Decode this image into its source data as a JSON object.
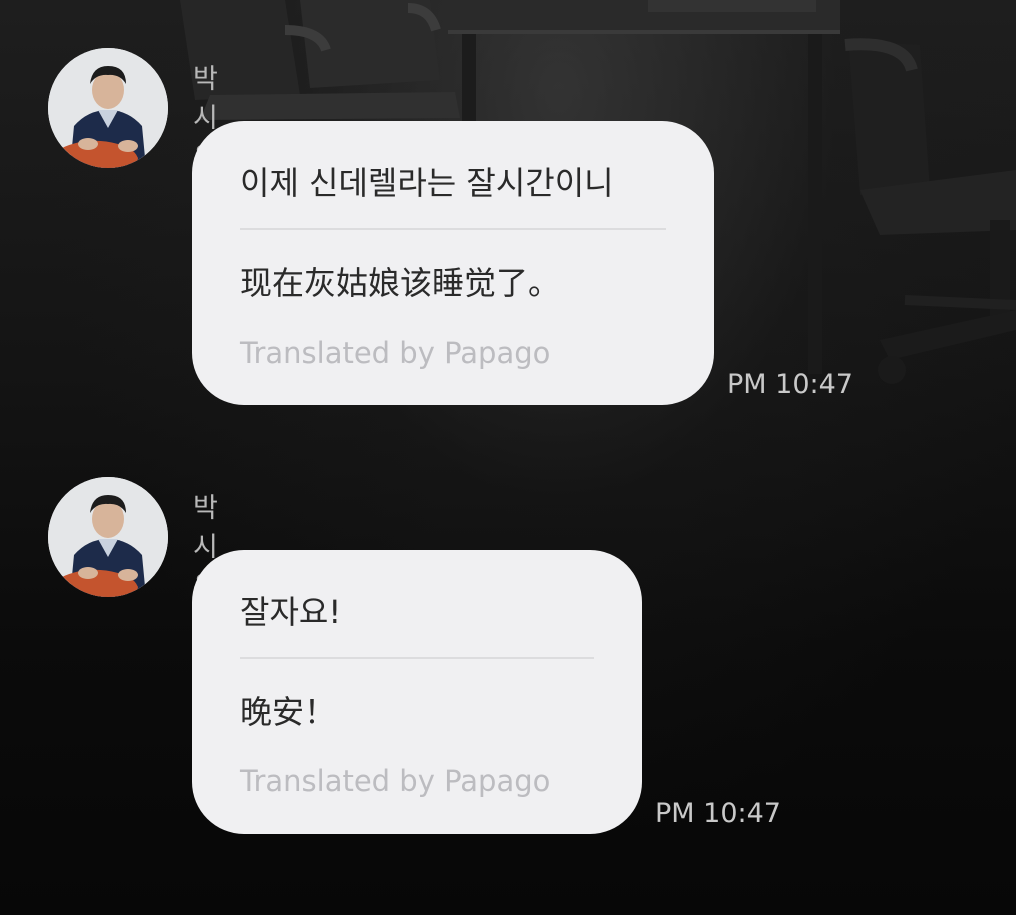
{
  "messages": [
    {
      "sender": "박시우",
      "original": "이제 신데렐라는 잘시간이니",
      "translated": "现在灰姑娘该睡觉了。",
      "credit": "Translated by Papago",
      "time": "PM 10:47"
    },
    {
      "sender": "박시우",
      "original": "잘자요!",
      "translated": "晚安！",
      "credit": "Translated by Papago",
      "time": "PM 10:47"
    }
  ],
  "icons": {
    "avatar": "profile-photo"
  },
  "colors": {
    "bubble": "#f0f0f2",
    "bubble_text": "#2a2a2a",
    "credit_text": "#bcbcc0",
    "sender_text": "#b9b9b9",
    "time_text": "#c9c9c9",
    "background": "#0d0d0d"
  }
}
